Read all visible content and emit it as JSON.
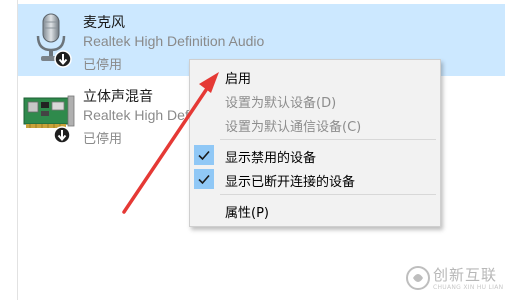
{
  "devices": [
    {
      "name": "麦克风",
      "description": "Realtek High Definition Audio",
      "status": "已停用",
      "icon": "microphone-icon",
      "badge_icon": "disabled-down-arrow-icon",
      "selected": true
    },
    {
      "name": "立体声混音",
      "description": "Realtek High Definition Audio",
      "status": "已停用",
      "icon": "sound-card-icon",
      "badge_icon": "disabled-down-arrow-icon",
      "selected": false
    }
  ],
  "context_menu": {
    "items": [
      {
        "label": "启用",
        "enabled": true,
        "checked": false
      },
      {
        "label": "设置为默认设备(D)",
        "enabled": false,
        "checked": false
      },
      {
        "label": "设置为默认通信设备(C)",
        "enabled": false,
        "checked": false
      },
      {
        "label": "显示禁用的设备",
        "enabled": true,
        "checked": true
      },
      {
        "label": "显示已断开连接的设备",
        "enabled": true,
        "checked": true
      },
      {
        "label": "属性(P)",
        "enabled": true,
        "checked": false
      }
    ]
  },
  "watermark": {
    "text": "创新互联",
    "subtext": "CHUANG XIN HU LIAN",
    "icon": "logo-icon"
  },
  "colors": {
    "selection": "#cce8ff",
    "check_background": "#90c8f6",
    "annotation_arrow": "#e53935"
  }
}
